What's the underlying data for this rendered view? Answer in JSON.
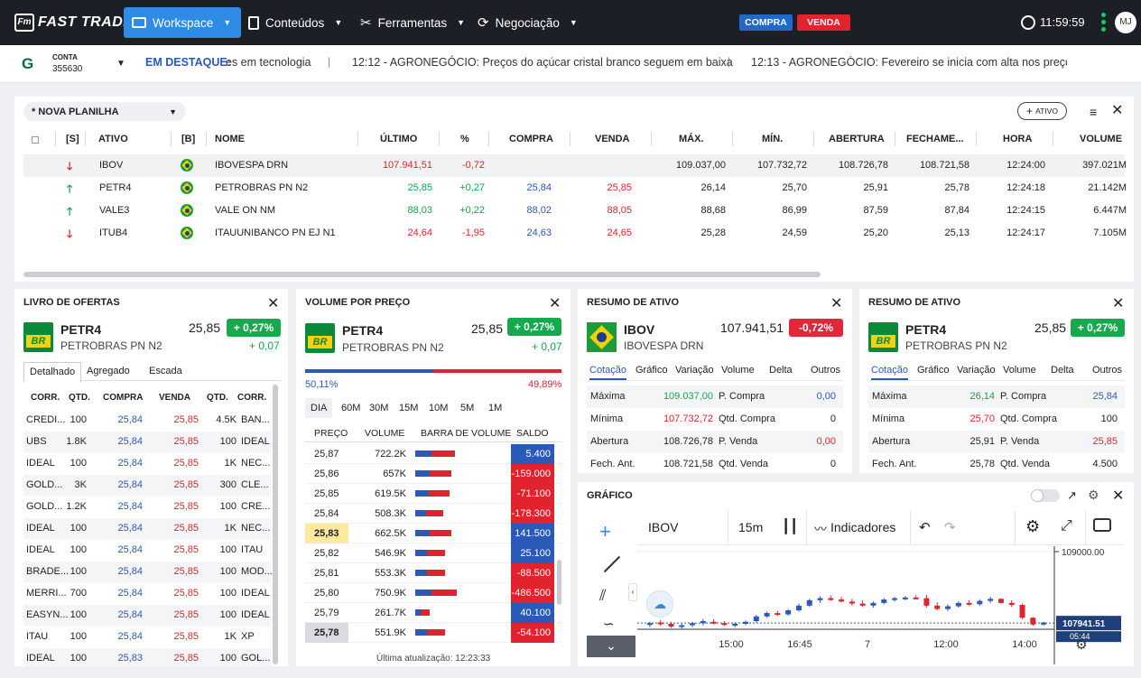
{
  "topbar": {
    "logo": "FAST TRADE",
    "nav": [
      {
        "label": "Workspace"
      },
      {
        "label": "Conteúdos"
      },
      {
        "label": "Ferramentas"
      },
      {
        "label": "Negociação"
      }
    ],
    "buy": "COMPRA",
    "sell": "VENDA",
    "time": "11:59:59",
    "avatar": "MJ"
  },
  "ticker": {
    "account_label": "CONTA",
    "account_number": "355630",
    "highlight_label": "EM DESTAQUE:",
    "items": [
      "es em tecnologia",
      "12:12 - AGRONEGÓCIO: Preços do açúcar cristal branco seguem em baixa",
      "12:13 - AGRONEGÓCIO: Fevereiro se inicia com alta nos preços dc"
    ]
  },
  "sheet": {
    "name": "* NOVA PLANILHA",
    "add_asset": "ATIVO",
    "columns": [
      "[S]",
      "ATIVO",
      "[B]",
      "NOME",
      "ÚLTIMO",
      "%",
      "COMPRA",
      "VENDA",
      "MÁX.",
      "MÍN.",
      "ABERTURA",
      "FECHAME...",
      "HORA",
      "VOLUME"
    ],
    "rows": [
      {
        "ativo": "IBOV",
        "nome": "IBOVESPA DRN",
        "ultimo": "107.941,51",
        "pct": "-0,72",
        "compra": "",
        "venda": "",
        "max": "109.037,00",
        "min": "107.732,72",
        "abertura": "108.726,78",
        "fechamento": "108.721,58",
        "hora": "12:24:00",
        "volume": "397.021M",
        "dir": "down"
      },
      {
        "ativo": "PETR4",
        "nome": "PETROBRAS PN N2",
        "ultimo": "25,85",
        "pct": "+0,27",
        "compra": "25,84",
        "venda": "25,85",
        "max": "26,14",
        "min": "25,70",
        "abertura": "25,91",
        "fechamento": "25,78",
        "hora": "12:24:18",
        "volume": "21.142M",
        "dir": "up"
      },
      {
        "ativo": "VALE3",
        "nome": "VALE ON NM",
        "ultimo": "88,03",
        "pct": "+0,22",
        "compra": "88,02",
        "venda": "88,05",
        "max": "88,68",
        "min": "86,99",
        "abertura": "87,59",
        "fechamento": "87,84",
        "hora": "12:24:15",
        "volume": "6.447M",
        "dir": "up"
      },
      {
        "ativo": "ITUB4",
        "nome": "ITAUUNIBANCO PN EJ N1",
        "ultimo": "24,64",
        "pct": "-1,95",
        "compra": "24,63",
        "venda": "24,65",
        "max": "25,28",
        "min": "24,59",
        "abertura": "25,20",
        "fechamento": "25,13",
        "hora": "12:24:17",
        "volume": "7.105M",
        "dir": "down"
      }
    ]
  },
  "book": {
    "title": "LIVRO DE OFERTAS",
    "symbol": "PETR4",
    "name": "PETROBRAS PN N2",
    "price": "25,85",
    "pct": "+ 0,27%",
    "change": "+ 0,07",
    "tabs": [
      "Detalhado",
      "Agregado",
      "Escada"
    ],
    "columns": [
      "CORR.",
      "QTD.",
      "COMPRA",
      "VENDA",
      "QTD.",
      "CORR."
    ],
    "rows": [
      [
        "CREDI...",
        "100",
        "25,84",
        "25,85",
        "4.5K",
        "BAN..."
      ],
      [
        "UBS",
        "1.8K",
        "25,84",
        "25,85",
        "100",
        "IDEAL"
      ],
      [
        "IDEAL",
        "100",
        "25,84",
        "25,85",
        "1K",
        "NEC..."
      ],
      [
        "GOLD...",
        "3K",
        "25,84",
        "25,85",
        "300",
        "CLE..."
      ],
      [
        "GOLD...",
        "1.2K",
        "25,84",
        "25,85",
        "100",
        "CRE..."
      ],
      [
        "IDEAL",
        "100",
        "25,84",
        "25,85",
        "1K",
        "NEC..."
      ],
      [
        "IDEAL",
        "100",
        "25,84",
        "25,85",
        "100",
        "ITAU"
      ],
      [
        "BRADE...",
        "100",
        "25,84",
        "25,85",
        "100",
        "MOD..."
      ],
      [
        "MERRI...",
        "700",
        "25,84",
        "25,85",
        "100",
        "IDEAL"
      ],
      [
        "EASYN...",
        "100",
        "25,84",
        "25,85",
        "100",
        "IDEAL"
      ],
      [
        "ITAU",
        "100",
        "25,84",
        "25,85",
        "1K",
        "XP"
      ],
      [
        "IDEAL",
        "100",
        "25,83",
        "25,85",
        "100",
        "GOL..."
      ]
    ]
  },
  "vpp": {
    "title": "VOLUME POR PREÇO",
    "symbol": "PETR4",
    "name": "PETROBRAS PN N2",
    "price": "25,85",
    "pct": "+ 0,27%",
    "change": "+ 0,07",
    "buy_pct": "50,11%",
    "sell_pct": "49,89%",
    "buy_share": 0.5011,
    "periods": [
      "DIA",
      "60M",
      "30M",
      "15M",
      "10M",
      "5M",
      "1M"
    ],
    "columns": [
      "PREÇO",
      "VOLUME",
      "BARRA DE VOLUME",
      "SALDO"
    ],
    "rows": [
      {
        "p": "25,87",
        "v": "722.2K",
        "s": "5.400",
        "b": 0.5,
        "sv": 5400
      },
      {
        "p": "25,86",
        "v": "657K",
        "s": "-159.000",
        "b": 0.46,
        "sv": -159000
      },
      {
        "p": "25,85",
        "v": "619.5K",
        "s": "-71.100",
        "b": 0.43,
        "sv": -71100
      },
      {
        "p": "25,84",
        "v": "508.3K",
        "s": "-178.300",
        "b": 0.35,
        "sv": -178300
      },
      {
        "p": "25,83",
        "v": "662.5K",
        "s": "141.500",
        "b": 0.46,
        "sv": 141500
      },
      {
        "p": "25,82",
        "v": "546.9K",
        "s": "25.100",
        "b": 0.38,
        "sv": 25100
      },
      {
        "p": "25,81",
        "v": "553.3K",
        "s": "-88.500",
        "b": 0.38,
        "sv": -88500
      },
      {
        "p": "25,80",
        "v": "750.9K",
        "s": "-486.500",
        "b": 0.52,
        "sv": -486500
      },
      {
        "p": "25,79",
        "v": "261.7K",
        "s": "40.100",
        "b": 0.18,
        "sv": 40100
      },
      {
        "p": "25,78",
        "v": "551.9K",
        "s": "-54.100",
        "b": 0.38,
        "sv": -54100
      }
    ],
    "updated": "Última atualização: 12:23:33"
  },
  "resumo_tabs": [
    "Cotação",
    "Gráfico",
    "Variação",
    "Volume",
    "Delta",
    "Outros"
  ],
  "resumo1": {
    "title": "RESUMO DE ATIVO",
    "symbol": "IBOV",
    "name": "IBOVESPA DRN",
    "price": "107.941,51",
    "pct": "-0,72%",
    "rows": [
      [
        "Máxima",
        "109.037,00",
        "P. Compra",
        "0,00"
      ],
      [
        "Mínima",
        "107.732,72",
        "Qtd. Compra",
        "0"
      ],
      [
        "Abertura",
        "108.726,78",
        "P. Venda",
        "0,00"
      ],
      [
        "Fech. Ant.",
        "108.721,58",
        "Qtd. Venda",
        "0"
      ]
    ]
  },
  "resumo2": {
    "title": "RESUMO DE ATIVO",
    "symbol": "PETR4",
    "name": "PETROBRAS PN N2",
    "price": "25,85",
    "pct": "+ 0,27%",
    "rows": [
      [
        "Máxima",
        "26,14",
        "P. Compra",
        "25,84"
      ],
      [
        "Mínima",
        "25,70",
        "Qtd. Compra",
        "100"
      ],
      [
        "Abertura",
        "25,91",
        "P. Venda",
        "25,85"
      ],
      [
        "Fech. Ant.",
        "25,78",
        "Qtd. Venda",
        "4.500"
      ]
    ]
  },
  "grafico": {
    "title": "GRÁFICO",
    "symbol": "IBOV",
    "interval": "15m",
    "indicators": "Indicadores",
    "price_level": "109000.00",
    "last_price": "107941.51",
    "last_partial": "05:44",
    "x_labels": [
      "15:00",
      "16:45",
      "7",
      "12:00",
      "14:00"
    ]
  },
  "chart_data": {
    "type": "candlestick",
    "symbol": "IBOV",
    "interval": "15m",
    "y_tick": 109000.0,
    "last": 107941.51,
    "candles": [
      [
        107920,
        107960,
        107880,
        107940
      ],
      [
        107950,
        107990,
        107900,
        107930
      ],
      [
        107930,
        107960,
        107870,
        107890
      ],
      [
        107890,
        107930,
        107860,
        107910
      ],
      [
        107910,
        107960,
        107880,
        107940
      ],
      [
        107940,
        108000,
        107910,
        107970
      ],
      [
        107960,
        108000,
        107920,
        107940
      ],
      [
        107940,
        107970,
        107900,
        107920
      ],
      [
        107920,
        107950,
        107880,
        107930
      ],
      [
        107930,
        107980,
        107910,
        107960
      ],
      [
        107970,
        108060,
        107950,
        108040
      ],
      [
        108040,
        108110,
        108020,
        108090
      ],
      [
        108090,
        108120,
        108050,
        108070
      ],
      [
        108070,
        108150,
        108050,
        108130
      ],
      [
        108130,
        108230,
        108110,
        108200
      ],
      [
        108200,
        108300,
        108180,
        108280
      ],
      [
        108280,
        108340,
        108240,
        108310
      ],
      [
        108310,
        108350,
        108270,
        108290
      ],
      [
        108290,
        108330,
        108250,
        108260
      ],
      [
        108260,
        108300,
        108200,
        108230
      ],
      [
        108230,
        108280,
        108180,
        108200
      ],
      [
        108200,
        108260,
        108170,
        108240
      ],
      [
        108240,
        108310,
        108220,
        108290
      ],
      [
        108290,
        108330,
        108260,
        108310
      ],
      [
        108310,
        108340,
        108280,
        108320
      ],
      [
        108320,
        108350,
        108290,
        108310
      ],
      [
        108310,
        108360,
        108170,
        108200
      ],
      [
        108200,
        108250,
        108130,
        108150
      ],
      [
        108150,
        108220,
        108120,
        108190
      ],
      [
        108190,
        108260,
        108170,
        108240
      ],
      [
        108240,
        108280,
        108200,
        108220
      ],
      [
        108220,
        108290,
        108200,
        108270
      ],
      [
        108270,
        108330,
        108240,
        108300
      ],
      [
        108300,
        108310,
        108230,
        108240
      ],
      [
        108240,
        108280,
        108180,
        108210
      ],
      [
        108210,
        108230,
        108000,
        108020
      ],
      [
        108020,
        108030,
        107900,
        107920
      ],
      [
        107920,
        107960,
        107900,
        107950
      ]
    ]
  }
}
